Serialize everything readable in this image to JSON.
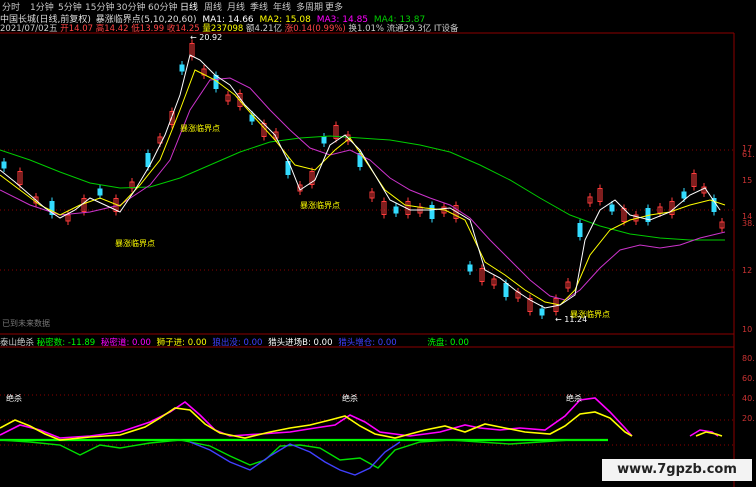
{
  "toolbar": {
    "items": [
      "分时",
      "1分钟",
      "5分钟",
      "15分钟",
      "30分钟",
      "60分钟",
      "日线",
      "周线",
      "月线",
      "季线",
      "年线",
      "多周期",
      "更多"
    ],
    "active_index": 6
  },
  "title": {
    "stock": "中国长城(日线,前复权)",
    "indicator": "暴涨临界点",
    "params": "(5,10,20,60)",
    "ma1_label": "MA1: 14.66",
    "ma2_label": "MA2: 15.08",
    "ma3_label": "MA3: 14.85",
    "ma4_label": "MA4: 13.87"
  },
  "info": {
    "date": "2021/07/02五",
    "open": "开14.07",
    "high": "高14.42",
    "low": "低13.99",
    "close": "收14.25",
    "volume": "量237098",
    "amount": "额4.21亿",
    "change": "涨0.14(0.99%)",
    "turnover": "换1.01%",
    "float": "流通29.3亿",
    "sector": "IT设备"
  },
  "annotations": {
    "peak": "20.92",
    "low": "11.24",
    "signal": "暴涨临界点",
    "no_future": "已到未来数据"
  },
  "right_axis": [
    "17",
    "61.",
    "15",
    "14",
    "38.",
    "12",
    "10"
  ],
  "indicator": {
    "name": "泰山绝杀",
    "items": [
      {
        "label": "秘密数",
        "value": "-11.89",
        "color": "#00ff00"
      },
      {
        "label": "秘密道",
        "value": "0.00",
        "color": "#ff00ff"
      },
      {
        "label": "狮子进",
        "value": "0.00",
        "color": "#ffff00"
      },
      {
        "label": "狼出没",
        "value": "0.00",
        "color": "#4040ff"
      },
      {
        "label": "猎头进场B",
        "value": "0.00",
        "color": "#ffffff"
      },
      {
        "label": "猎头增仓",
        "value": "0.00",
        "color": "#4040ff"
      },
      {
        "label": "洗盘",
        "value": "0.00",
        "color": "#00ff00"
      }
    ],
    "signal": "绝杀"
  },
  "right_axis_lower": [
    "80.",
    "60.",
    "40.",
    "20."
  ],
  "watermark": "www.7gpzb.com",
  "colors": {
    "up": "#ff3c3c",
    "down": "#33dcff",
    "ma1": "#ffffff",
    "ma2": "#ffff00",
    "ma3": "#ff00ff",
    "ma4": "#00cc00",
    "grid_dotted": "#8b0000"
  }
}
